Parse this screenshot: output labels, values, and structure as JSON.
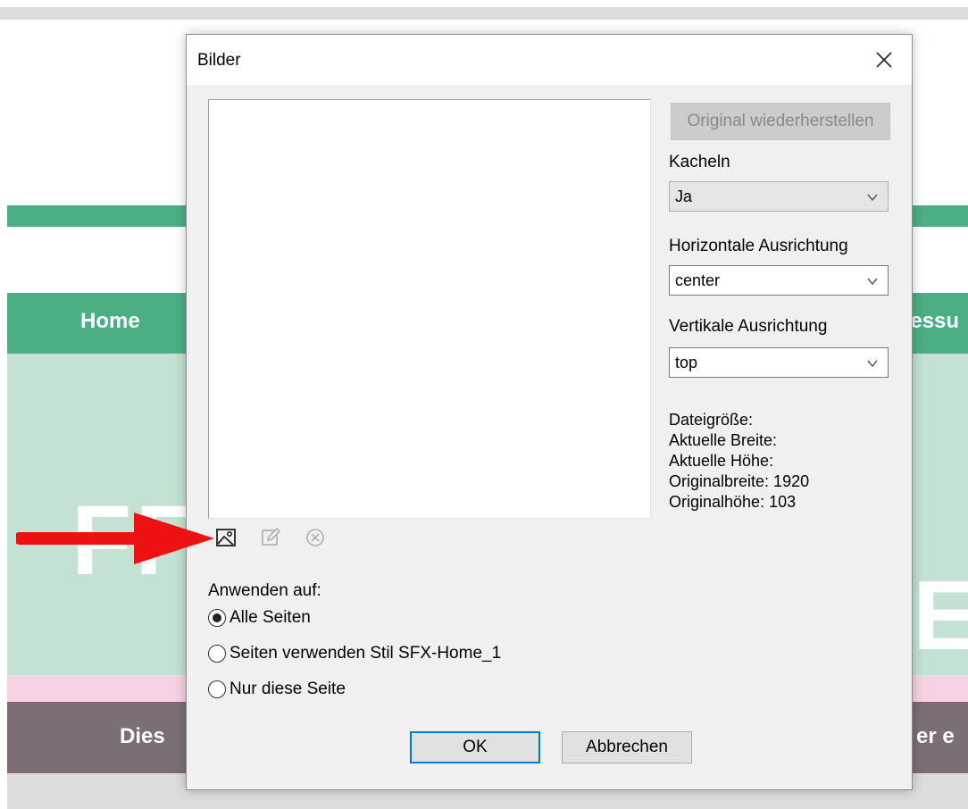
{
  "background": {
    "nav_home": "Home",
    "nav_right_fragment": "ressu",
    "hero_left": "FF",
    "hero_right": "E",
    "footer_left": "Dies",
    "footer_right": "er e",
    "colors": {
      "green": "#4caf84",
      "mint": "#c3e2d3",
      "pink": "#f6d2e3",
      "taupe": "#7b6e77"
    }
  },
  "dialog": {
    "title": "Bilder",
    "close_icon": "close-icon",
    "restore_label": "Original wiederherstellen",
    "tiles": {
      "label": "Kacheln",
      "value": "Ja"
    },
    "horizontal": {
      "label": "Horizontale Ausrichtung",
      "value": "center"
    },
    "vertical": {
      "label": "Vertikale Ausrichtung",
      "value": "top"
    },
    "info": {
      "file_size": "Dateigröße:",
      "current_width": "Aktuelle Breite:",
      "current_height": "Aktuelle Höhe:",
      "original_width": "Originalbreite: 1920",
      "original_height": "Originalhöhe: 103"
    },
    "tools": [
      "add-image-icon",
      "edit-icon",
      "remove-icon"
    ],
    "apply_to": {
      "label": "Anwenden auf:",
      "options": [
        {
          "label": "Alle Seiten",
          "selected": true
        },
        {
          "label": "Seiten verwenden Stil SFX-Home_1",
          "selected": false
        },
        {
          "label": "Nur diese Seite",
          "selected": false
        }
      ]
    },
    "ok_label": "OK",
    "cancel_label": "Abbrechen",
    "accent": "#0078d7"
  },
  "annotation": {
    "arrow_color": "#ee1111"
  }
}
